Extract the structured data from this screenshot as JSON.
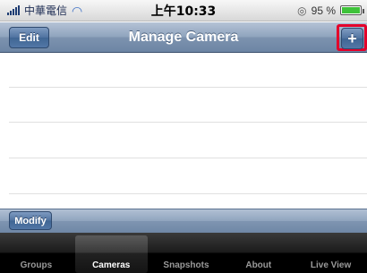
{
  "status_bar": {
    "carrier": "中華電信",
    "time": "上午10:33",
    "battery": "95 %",
    "battery_level": 0.95
  },
  "nav": {
    "title": "Manage Camera",
    "edit_label": "Edit",
    "add_label": "+"
  },
  "toolbar": {
    "modify_label": "Modify"
  },
  "tabs": [
    {
      "label": "Groups"
    },
    {
      "label": "Cameras",
      "active": true
    },
    {
      "label": "Snapshots"
    },
    {
      "label": "About"
    },
    {
      "label": "Live View"
    }
  ],
  "colors": {
    "highlight_border": "#e3002a",
    "nav_blue": "#6d85a4",
    "battery_green": "#3fc23a"
  }
}
